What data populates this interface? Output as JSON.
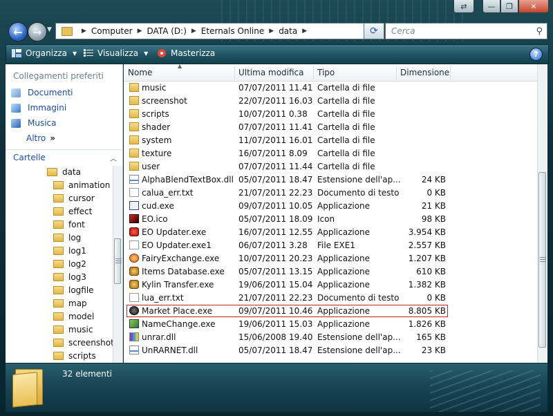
{
  "window": {
    "caption_buttons": [
      "⇄",
      "—",
      "❐",
      "✕"
    ]
  },
  "nav": {
    "breadcrumb": [
      "Computer",
      "DATA (D:)",
      "Eternals Online",
      "data"
    ],
    "search_placeholder": "Cerca"
  },
  "toolbar": {
    "organize_label": "Organizza",
    "views_label": "Visualizza",
    "burn_label": "Masterizza",
    "help_label": "?"
  },
  "left": {
    "favorites_heading": "Collegamenti preferiti",
    "favorites": [
      "Documenti",
      "Immagini",
      "Musica"
    ],
    "more_label": "Altro",
    "more_arrows": "»",
    "folders_label": "Cartelle",
    "tree": [
      "data",
      "animation",
      "cursor",
      "effect",
      "font",
      "log",
      "log1",
      "log2",
      "log3",
      "logfile",
      "map",
      "model",
      "music",
      "screenshot",
      "scripts"
    ]
  },
  "list": {
    "columns": [
      "Nome",
      "Ultima modifica",
      "Tipo",
      "Dimensione"
    ],
    "rows": [
      {
        "name": "music",
        "date": "07/07/2011 11.41",
        "type": "Cartella di file",
        "size": "",
        "icon": "folder"
      },
      {
        "name": "screenshot",
        "date": "22/07/2011 16.03",
        "type": "Cartella di file",
        "size": "",
        "icon": "folder"
      },
      {
        "name": "scripts",
        "date": "10/07/2011 0.38",
        "type": "Cartella di file",
        "size": "",
        "icon": "folder"
      },
      {
        "name": "shader",
        "date": "07/07/2011 11.41",
        "type": "Cartella di file",
        "size": "",
        "icon": "folder"
      },
      {
        "name": "system",
        "date": "11/07/2011 16.01",
        "type": "Cartella di file",
        "size": "",
        "icon": "folder"
      },
      {
        "name": "texture",
        "date": "16/07/2011 8.09",
        "type": "Cartella di file",
        "size": "",
        "icon": "folder"
      },
      {
        "name": "user",
        "date": "07/07/2011 11.44",
        "type": "Cartella di file",
        "size": "",
        "icon": "folder"
      },
      {
        "name": "AlphaBlendTextBox.dll",
        "date": "05/07/2011 18.47",
        "type": "Estensione dell'ap...",
        "size": "24 KB",
        "icon": "dll"
      },
      {
        "name": "calua_err.txt",
        "date": "21/07/2011 22.23",
        "type": "Documento di testo",
        "size": "0 KB",
        "icon": "file"
      },
      {
        "name": "cud.exe",
        "date": "09/07/2011 10.05",
        "type": "Applicazione",
        "size": "21 KB",
        "icon": "app"
      },
      {
        "name": "EO.ico",
        "date": "05/07/2011 18.09",
        "type": "Icon",
        "size": "98 KB",
        "icon": "ico"
      },
      {
        "name": "EO Updater.exe",
        "date": "16/07/2011 12.55",
        "type": "Applicazione",
        "size": "3.954 KB",
        "icon": "red"
      },
      {
        "name": "EO Updater.exe1",
        "date": "06/07/2011 3.28",
        "type": "File EXE1",
        "size": "2.557 KB",
        "icon": "file"
      },
      {
        "name": "FairyExchange.exe",
        "date": "10/07/2011 20.23",
        "type": "Applicazione",
        "size": "1.207 KB",
        "icon": "fairy"
      },
      {
        "name": "Items Database.exe",
        "date": "05/07/2011 13.15",
        "type": "Applicazione",
        "size": "610 KB",
        "icon": "gold"
      },
      {
        "name": "Kylin Transfer.exe",
        "date": "19/06/2011 15.04",
        "type": "Applicazione",
        "size": "1.382 KB",
        "icon": "gold"
      },
      {
        "name": "lua_err.txt",
        "date": "21/07/2011 22.23",
        "type": "Documento di testo",
        "size": "0 KB",
        "icon": "file"
      },
      {
        "name": "Market Place.exe",
        "date": "09/07/2011 10.46",
        "type": "Applicazione",
        "size": "8.805 KB",
        "icon": "black"
      },
      {
        "name": "NameChange.exe",
        "date": "19/06/2011 15.03",
        "type": "Applicazione",
        "size": "1.826 KB",
        "icon": "green"
      },
      {
        "name": "unrar.dll",
        "date": "15/06/2008 19.40",
        "type": "Estensione dell'ap...",
        "size": "165 KB",
        "icon": "rar"
      },
      {
        "name": "UnRARNET.dll",
        "date": "05/07/2011 18.47",
        "type": "Estensione dell'ap...",
        "size": "23 KB",
        "icon": "dll"
      }
    ]
  },
  "details": {
    "count_text": "32 elementi"
  },
  "colors": {
    "accent": "#1b4ea8",
    "highlight_border": "#c0282a",
    "toolbar_bg": "#1f5565"
  }
}
